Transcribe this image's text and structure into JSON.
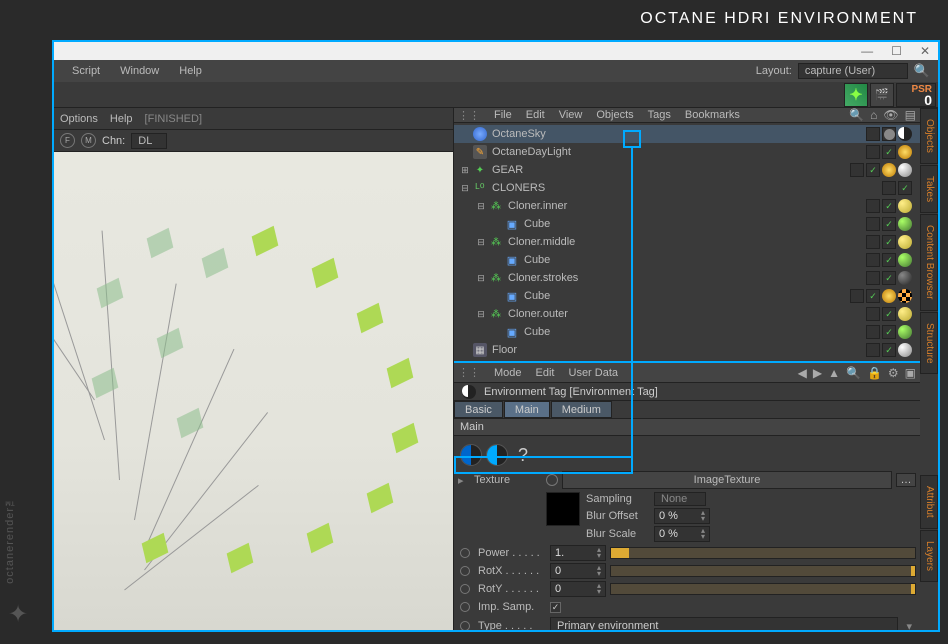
{
  "banner": {
    "title": "OCTANE HDRI ENVIRONMENT"
  },
  "watermark": "octanerender™",
  "titlebar": {
    "minimize": "—",
    "maximize": "☐",
    "close": "✕"
  },
  "main_menu": {
    "script": "Script",
    "window": "Window",
    "help": "Help",
    "layout_label": "Layout:",
    "layout_value": "capture (User)"
  },
  "toolbar": {
    "psr": "PSR",
    "psr_num": "0"
  },
  "viewport": {
    "menu": {
      "options": "Options",
      "help": "Help"
    },
    "status": "[FINISHED]",
    "channel_label": "Chn:",
    "channel_value": "DL"
  },
  "objects": {
    "menu": {
      "file": "File",
      "edit": "Edit",
      "view": "View",
      "objects": "Objects",
      "tags": "Tags",
      "bookmarks": "Bookmarks"
    },
    "tree": [
      {
        "indent": 0,
        "icon": "sky",
        "label": "OctaneSky",
        "expand": "",
        "selected": true,
        "tags": [
          "box",
          "dot",
          "env"
        ]
      },
      {
        "indent": 0,
        "icon": "light",
        "label": "OctaneDayLight",
        "expand": "",
        "tags": [
          "box",
          "check",
          "sun"
        ]
      },
      {
        "indent": 0,
        "icon": "gear",
        "label": "GEAR",
        "expand": "⊞",
        "tags": [
          "box",
          "check",
          "sun",
          "sphere"
        ]
      },
      {
        "indent": 0,
        "icon": "null",
        "label": "CLONERS",
        "expand": "⊟",
        "tags": [
          "box",
          "check"
        ]
      },
      {
        "indent": 1,
        "icon": "cloner",
        "label": "Cloner.inner",
        "expand": "⊟",
        "tags": [
          "box",
          "check",
          "yellow"
        ]
      },
      {
        "indent": 2,
        "icon": "cube",
        "label": "Cube",
        "expand": "",
        "tags": [
          "box",
          "check",
          "green"
        ]
      },
      {
        "indent": 1,
        "icon": "cloner",
        "label": "Cloner.middle",
        "expand": "⊟",
        "tags": [
          "box",
          "check",
          "yellow"
        ]
      },
      {
        "indent": 2,
        "icon": "cube",
        "label": "Cube",
        "expand": "",
        "tags": [
          "box",
          "check",
          "green"
        ]
      },
      {
        "indent": 1,
        "icon": "cloner",
        "label": "Cloner.strokes",
        "expand": "⊟",
        "tags": [
          "box",
          "check",
          "dark"
        ]
      },
      {
        "indent": 2,
        "icon": "cube",
        "label": "Cube",
        "expand": "",
        "tags": [
          "box",
          "check",
          "sun",
          "checker"
        ]
      },
      {
        "indent": 1,
        "icon": "cloner",
        "label": "Cloner.outer",
        "expand": "⊟",
        "tags": [
          "box",
          "check",
          "yellow"
        ]
      },
      {
        "indent": 2,
        "icon": "cube",
        "label": "Cube",
        "expand": "",
        "tags": [
          "box",
          "check",
          "green"
        ]
      },
      {
        "indent": 0,
        "icon": "floor",
        "label": "Floor",
        "expand": "",
        "tags": [
          "box",
          "check",
          "sphere"
        ]
      }
    ]
  },
  "side_tabs": [
    "Objects",
    "Takes",
    "Content Browser",
    "Structure"
  ],
  "side_tabs_lower": [
    "Attribut",
    "Layers"
  ],
  "attributes": {
    "menu": {
      "mode": "Mode",
      "edit": "Edit",
      "user_data": "User Data"
    },
    "title": "Environment Tag [Environment Tag]",
    "tabs": {
      "basic": "Basic",
      "main": "Main",
      "medium": "Medium"
    },
    "section": "Main",
    "question": "?",
    "texture_label": "Texture",
    "texture_value": "ImageTexture",
    "sampling_label": "Sampling",
    "sampling_value": "None",
    "blur_offset_label": "Blur Offset",
    "blur_offset_value": "0 %",
    "blur_scale_label": "Blur Scale",
    "blur_scale_value": "0 %",
    "power_label": "Power . . . . .",
    "power_value": "1.",
    "rotx_label": "RotX . . . . . .",
    "rotx_value": "0",
    "roty_label": "RotY . . . . . .",
    "roty_value": "0",
    "impsamp_label": "Imp. Samp.",
    "type_label": "Type  . . . . .",
    "type_value": "Primary environment"
  }
}
